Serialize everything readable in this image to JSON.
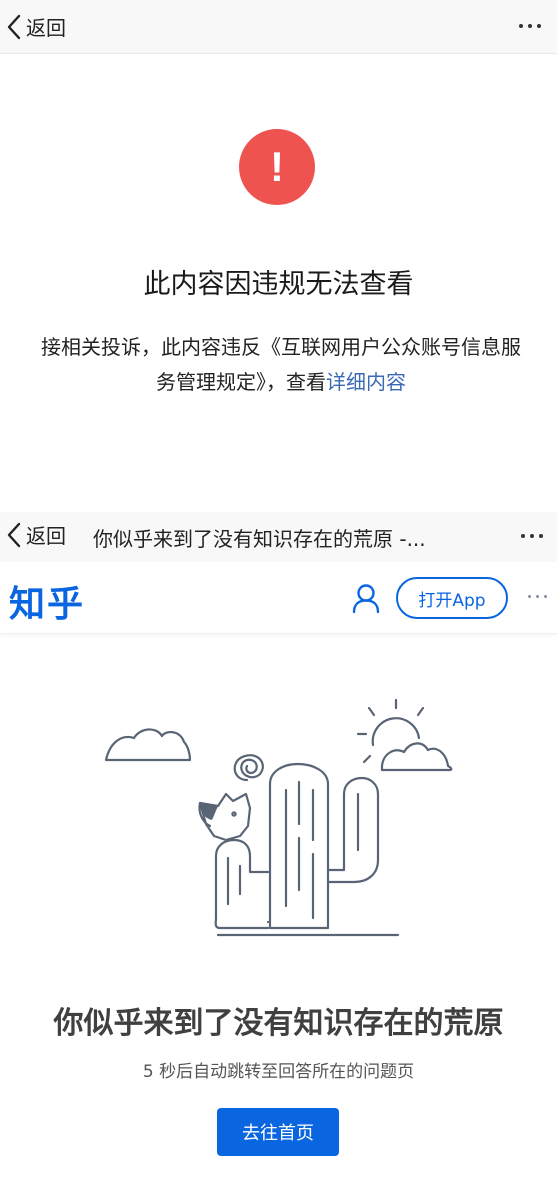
{
  "first_screen": {
    "nav": {
      "back_label": "返回"
    },
    "title": "此内容因违规无法查看",
    "description": "接相关投诉，此内容违反《互联网用户公众账号信息服务管理规定》，查看",
    "link": "详细内容"
  },
  "second_screen": {
    "nav": {
      "back_label": "返回",
      "title": "你似乎来到了没有知识存在的荒原 -..."
    },
    "header": {
      "logo": "知乎",
      "open_app_label": "打开App"
    },
    "error_title": "你似乎来到了没有知识存在的荒原",
    "redirect_text": "5 秒后自动跳转至回答所在的问题页",
    "home_button": "去往首页"
  },
  "icons": [
    "chevron-left-icon",
    "more-icon",
    "alert-icon",
    "user-icon"
  ],
  "colors": {
    "alert_red": "#ef5350",
    "link_blue": "#3b6ab4",
    "zhihu_blue": "#0a66e0"
  }
}
